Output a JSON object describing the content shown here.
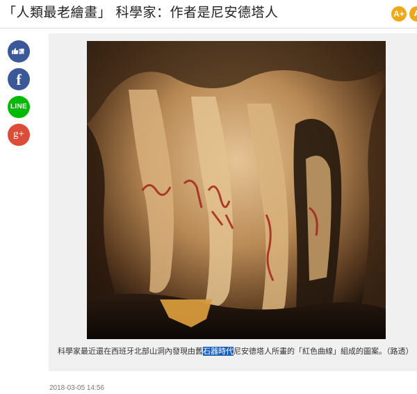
{
  "header": {
    "title": "「人類最老繪畫」 科學家：作者是尼安德塔人",
    "font_size_button_label": "A+",
    "font_size_button2_label": "A"
  },
  "share": {
    "like_label": "讚",
    "facebook_label": "f",
    "line_label": "LINE",
    "gplus_label": "g+"
  },
  "article": {
    "image_icon": "cave-painting-photo",
    "caption_before": "科學家最近還在西班牙北部山洞內發現由舊",
    "caption_highlight": "石器時代",
    "caption_after": "尼安德塔人所畫的「紅色曲線」組成的圖案。（路透）",
    "timestamp": "2018-03-05 14:56"
  },
  "colors": {
    "facebook": "#3b5998",
    "line": "#00b900",
    "gplus": "#dd4b39",
    "font_button": "#f0a818",
    "highlight": "#1c5fb8"
  }
}
